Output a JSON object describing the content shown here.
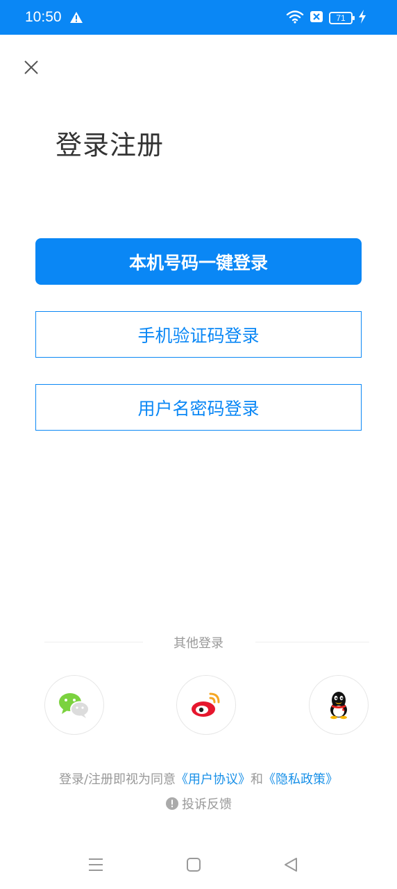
{
  "status_bar": {
    "time": "10:50",
    "battery_level": "71",
    "icons": [
      "warning-icon",
      "wifi-icon",
      "sim-blocked-icon",
      "battery-icon",
      "charging-icon"
    ]
  },
  "header": {
    "close_icon": "close-icon",
    "title": "登录注册"
  },
  "login_options": {
    "one_click_label": "本机号码一键登录",
    "sms_label": "手机验证码登录",
    "password_label": "用户名密码登录"
  },
  "other_login": {
    "label": "其他登录",
    "providers": [
      "wechat-icon",
      "weibo-icon",
      "qq-icon"
    ]
  },
  "agreement": {
    "prefix": "登录/注册即视为同意",
    "user_agreement": "《用户协议》",
    "and": "和",
    "privacy_policy": "《隐私政策》"
  },
  "complaint": {
    "label": "投诉反馈"
  },
  "colors": {
    "accent": "#0a87f5",
    "link": "#1890e8",
    "muted_text": "#999999",
    "title_text": "#333333"
  }
}
